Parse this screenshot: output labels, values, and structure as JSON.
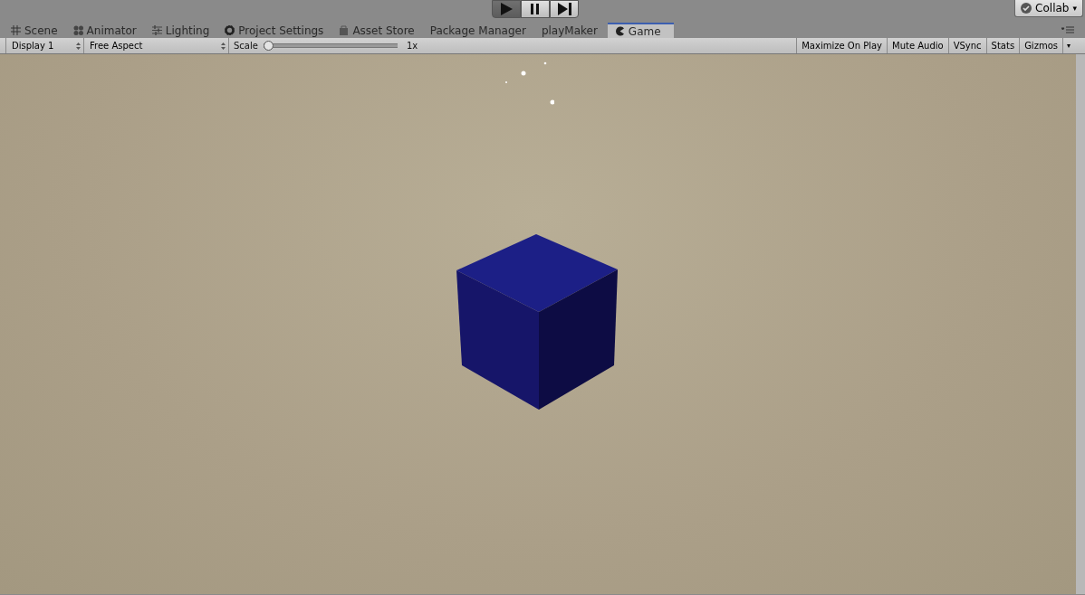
{
  "play_controls": [
    {
      "kind": "play",
      "on": true
    },
    {
      "kind": "pause",
      "on": false
    },
    {
      "kind": "step",
      "on": false
    }
  ],
  "collab": {
    "label": "Collab",
    "caret": "▾"
  },
  "tabs": [
    {
      "label": "Scene",
      "kind": "scene",
      "selected": false
    },
    {
      "label": "Animator",
      "kind": "animator",
      "selected": false
    },
    {
      "label": "Lighting",
      "kind": "lighting",
      "selected": false
    },
    {
      "label": "Project Settings",
      "kind": "settings",
      "selected": false
    },
    {
      "label": "Asset Store",
      "kind": "store",
      "selected": false
    },
    {
      "label": "Package Manager",
      "kind": "packages",
      "selected": false
    },
    {
      "label": "playMaker",
      "kind": "plugin",
      "selected": false
    },
    {
      "label": "Game",
      "kind": "game",
      "selected": true
    }
  ],
  "toolbar": {
    "display": "Display 1",
    "aspect": "Free Aspect",
    "scale_label": "Scale",
    "scale": {
      "level": 0
    },
    "scale_value": "1x",
    "toggles": [
      {
        "label": "Maximize On Play",
        "on": false
      },
      {
        "label": "Mute Audio",
        "on": false
      },
      {
        "label": "VSync",
        "on": false
      },
      {
        "label": "Stats",
        "on": false
      },
      {
        "label": "Gizmos",
        "on": false
      }
    ],
    "gizmos_caret": "▾"
  }
}
